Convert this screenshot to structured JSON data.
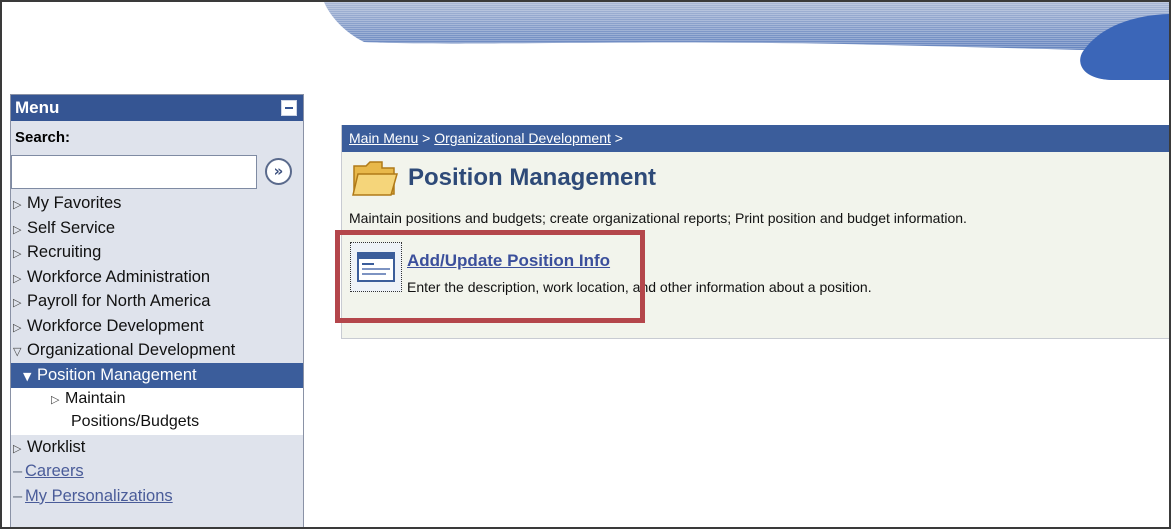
{
  "menu": {
    "title": "Menu",
    "search_label": "Search:",
    "search_value": "",
    "search_go_glyph": "»",
    "items": [
      {
        "label": "My Favorites",
        "arrow": "▷"
      },
      {
        "label": "Self Service",
        "arrow": "▷"
      },
      {
        "label": "Recruiting",
        "arrow": "▷"
      },
      {
        "label": "Workforce Administration",
        "arrow": "▷"
      },
      {
        "label": "Payroll for North America",
        "arrow": "▷"
      },
      {
        "label": "Workforce Development",
        "arrow": "▷"
      },
      {
        "label": "Organizational Development",
        "arrow": "▽"
      }
    ],
    "active_sub": {
      "label": "Position Management",
      "arrow": "▼"
    },
    "sub_child": {
      "label_line1": "Maintain",
      "label_line2": "Positions/Budgets",
      "arrow": "▷"
    },
    "bottom_items": [
      {
        "label": "Worklist",
        "arrow": "▷"
      }
    ],
    "links": [
      {
        "label": "Careers",
        "dash": "–"
      },
      {
        "label": "My Personalizations",
        "dash": "–"
      }
    ]
  },
  "breadcrumb": {
    "main_menu": "Main Menu",
    "sep1": " > ",
    "org_dev": "Organizational Development",
    "sep2": " >"
  },
  "page": {
    "title": "Position Management",
    "description": "Maintain positions and budgets; create organizational reports; Print position and budget information."
  },
  "entry": {
    "link": "Add/Update Position Info",
    "description": "Enter the description, work location, and other information about a position."
  },
  "colors": {
    "header_blue": "#355593",
    "breadcrumb_blue": "#3b5d9b",
    "highlight_red": "#b4464b",
    "content_bg": "#f2f4ec"
  }
}
